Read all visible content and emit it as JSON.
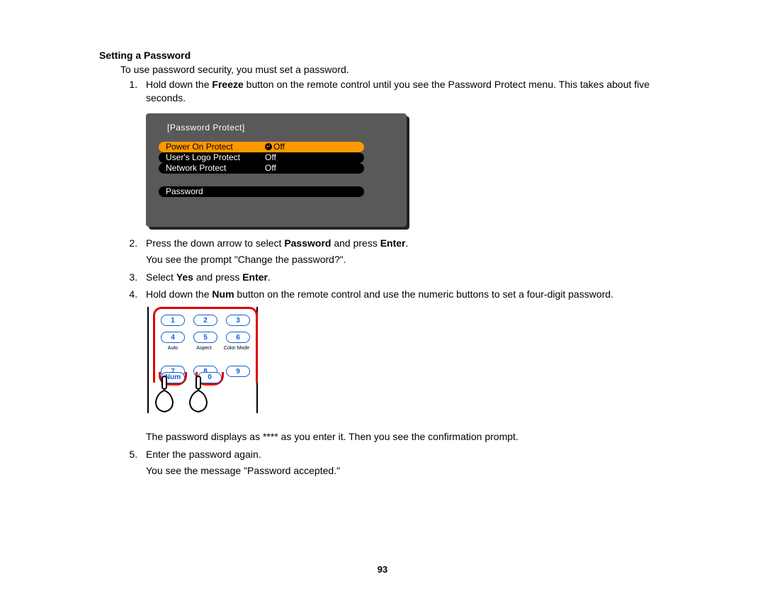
{
  "heading": "Setting a Password",
  "intro": "To use password security, you must set a password.",
  "steps": {
    "s1a": "Hold down the ",
    "s1b": "Freeze",
    "s1c": " button on the remote control until you see the Password Protect menu. This takes about five seconds.",
    "s2a": "Press the down arrow to select ",
    "s2b": "Password",
    "s2c": " and press ",
    "s2d": "Enter",
    "s2e": ".",
    "s2_note": "You see the prompt \"Change the password?\".",
    "s3a": "Select ",
    "s3b": "Yes",
    "s3c": " and press ",
    "s3d": "Enter",
    "s3e": ".",
    "s4a": "Hold down the ",
    "s4b": "Num",
    "s4c": " button on the remote control and use the numeric buttons to set a four-digit password.",
    "s4_note": "The password displays as **** as you enter it. Then you see the confirmation prompt.",
    "s5": "Enter the password again.",
    "s5_note": "You see the message \"Password accepted.\""
  },
  "osd": {
    "title": "[Password Protect]",
    "row1_label": "Power On Protect",
    "row1_value": "Off",
    "row2_label": "User's Logo Protect",
    "row2_value": "Off",
    "row3_label": "Network Protect",
    "row3_value": "Off",
    "row4_label": "Password"
  },
  "keypad": {
    "b1": "1",
    "b2": "2",
    "b3": "3",
    "b4": "4",
    "b5": "5",
    "b6": "6",
    "l7": "Auto",
    "l8": "Aspect",
    "l9": "Color Mode",
    "b7": "7",
    "b8": "8",
    "b9": "9",
    "num": "Num",
    "b0": "0"
  },
  "page_number": "93"
}
